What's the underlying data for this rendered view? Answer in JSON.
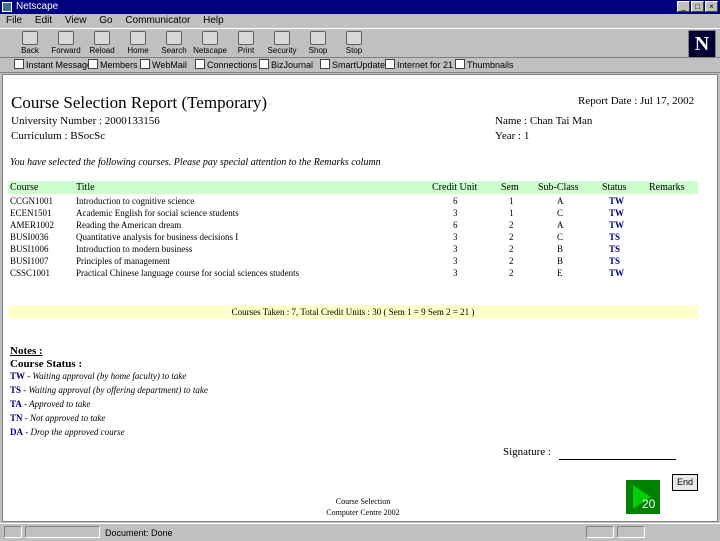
{
  "window": {
    "title": "Netscape"
  },
  "menu": [
    "File",
    "Edit",
    "View",
    "Go",
    "Communicator",
    "Help"
  ],
  "toolbar": [
    "Back",
    "Forward",
    "Reload",
    "Home",
    "Search",
    "Netscape",
    "Print",
    "Security",
    "Shop",
    "Stop"
  ],
  "personal": [
    "Instant Message",
    "Members",
    "WebMail",
    "Connections",
    "BizJournal",
    "SmartUpdate",
    "Internet for 21",
    "Thumbnails"
  ],
  "report": {
    "title": "Course Selection Report (Temporary)",
    "date": "Report Date : Jul 17, 2002",
    "university_number": "University Number : 2000133156",
    "curriculum": "Curriculum : BSocSc",
    "name": "Name : Chan Tai Man",
    "year": "Year : 1",
    "notice": "You have selected the following courses. Please pay special attention to the Remarks column",
    "columns": [
      "Course",
      "Title",
      "Credit Unit",
      "Sem",
      "Sub-Class",
      "Status",
      "Remarks"
    ],
    "rows": [
      {
        "course": "CCGN1001",
        "title": "Introduction to cognitive science",
        "credit": "6",
        "sem": "1",
        "sub": "A",
        "status": "TW"
      },
      {
        "course": "ECEN1501",
        "title": "Academic English for social science students",
        "credit": "3",
        "sem": "1",
        "sub": "C",
        "status": "TW"
      },
      {
        "course": "AMER1002",
        "title": "Reading the American dream",
        "credit": "6",
        "sem": "2",
        "sub": "A",
        "status": "TW"
      },
      {
        "course": "BUSI0036",
        "title": "Quantitative analysis for business decisions I",
        "credit": "3",
        "sem": "2",
        "sub": "C",
        "status": "TS"
      },
      {
        "course": "BUSI1006",
        "title": "Introduction to modern business",
        "credit": "3",
        "sem": "2",
        "sub": "B",
        "status": "TS"
      },
      {
        "course": "BUSI1007",
        "title": "Principles of management",
        "credit": "3",
        "sem": "2",
        "sub": "B",
        "status": "TS"
      },
      {
        "course": "CSSC1001",
        "title": "Practical Chinese language course for social sciences students",
        "credit": "3",
        "sem": "2",
        "sub": "E",
        "status": "TW"
      }
    ],
    "summary": "Courses Taken : 7,    Total Credit Units : 30  (   Sem 1 = 9   Sem 2 = 21  )",
    "notes_heading": "Notes :",
    "status_heading": "Course Status :",
    "statuses": [
      {
        "code": "TW",
        "desc": " - Waiting approval (by home faculty) to take"
      },
      {
        "code": "TS",
        "desc": " - Waiting approval (by offering department) to take"
      },
      {
        "code": "TA",
        "desc": " - Approved to take"
      },
      {
        "code": "TN",
        "desc": " - Not approved to take"
      },
      {
        "code": "DA",
        "desc": " - Drop the approved course"
      }
    ],
    "signature": "Signature :",
    "end_button": "End",
    "footer_line1": "Course Selection",
    "footer_line2": "Computer Centre 2002"
  },
  "slide_number": "20",
  "statusbar": {
    "text": "Document: Done"
  }
}
